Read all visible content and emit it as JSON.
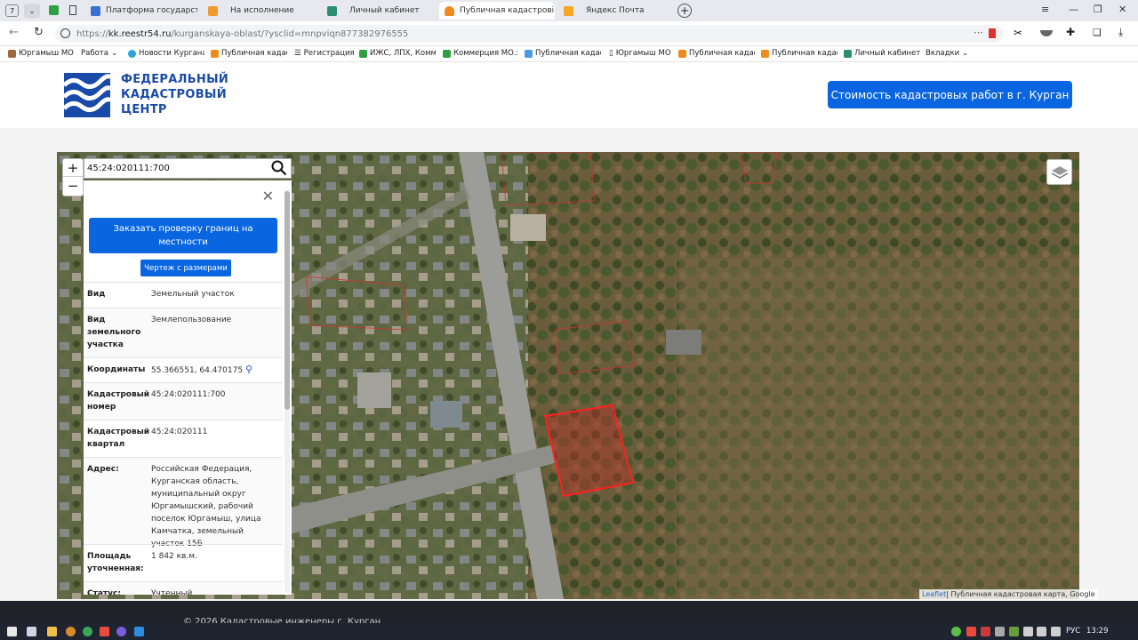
{
  "browser": {
    "tab_count": "7",
    "tabs": [
      {
        "label": "Платформа государстве",
        "color": "#3b6fd1"
      },
      {
        "label": "На исполнение",
        "color": "#f29a2e"
      },
      {
        "label": "Личный кабинет",
        "color": "#2a8f6e"
      },
      {
        "label": "Публичная кадастрові",
        "color": "#f08a1c"
      },
      {
        "label": "Яндекс Почта",
        "color": "#f5a623"
      }
    ],
    "url_prefix": "https://",
    "url_host": "kk.reestr54.ru",
    "url_path": "/kurganskaya-oblast/?ysclid=mnpviqn877382976555",
    "bookmarks": [
      "Юргамыш МО",
      "Работа",
      "Новости Кургана",
      "Публичная кадас",
      "Регистрация",
      "ИЖС, ЛПХ, Комм",
      "Коммерция МО.х",
      "Публичная кадас",
      "Юргамыш МО",
      "Публичная кадас",
      "Публичная кадас",
      "Личный кабинет",
      "Вкладки"
    ]
  },
  "site": {
    "logo_lines": [
      "ФЕДЕРАЛЬНЫЙ",
      "КАДАСТРОВЫЙ",
      "ЦЕНТР"
    ],
    "cta_label": "Стоимость кадастровых работ в г. Курган",
    "footer_text": "© 2026 Кадастровые инженеры г. Курган"
  },
  "map": {
    "zoom_in": "+",
    "zoom_out": "−",
    "search_value": "45:24:020111:700",
    "attribution_link": "Leaflet",
    "attribution_text": " | Публичная кадастровая карта, Google"
  },
  "panel": {
    "order_button": "Заказать проверку границ на местности",
    "drawing_button": "Чертеж с размерами",
    "rows": [
      {
        "key": "Вид",
        "value": "Земельный участок"
      },
      {
        "key": "Вид земельного участка",
        "value": "Землепользование"
      },
      {
        "key": "Координаты",
        "value": "55.366551, 64.470175"
      },
      {
        "key": "Кадастровый номер",
        "value": "45:24:020111:700"
      },
      {
        "key": "Кадастровый квартал",
        "value": "45:24:020111"
      },
      {
        "key": "Адрес:",
        "value": "Российская Федерация, Курганская область, муниципальный округ Юргамышский, рабочий поселок Юргамыш, улица Камчатка, земельный участок 15Б"
      },
      {
        "key": "Площадь уточненная:",
        "value": "1 842 кв.м."
      },
      {
        "key": "Статус:",
        "value": "Учтенный"
      }
    ]
  },
  "taskbar": {
    "lang": "РУС",
    "time": "13:29"
  }
}
